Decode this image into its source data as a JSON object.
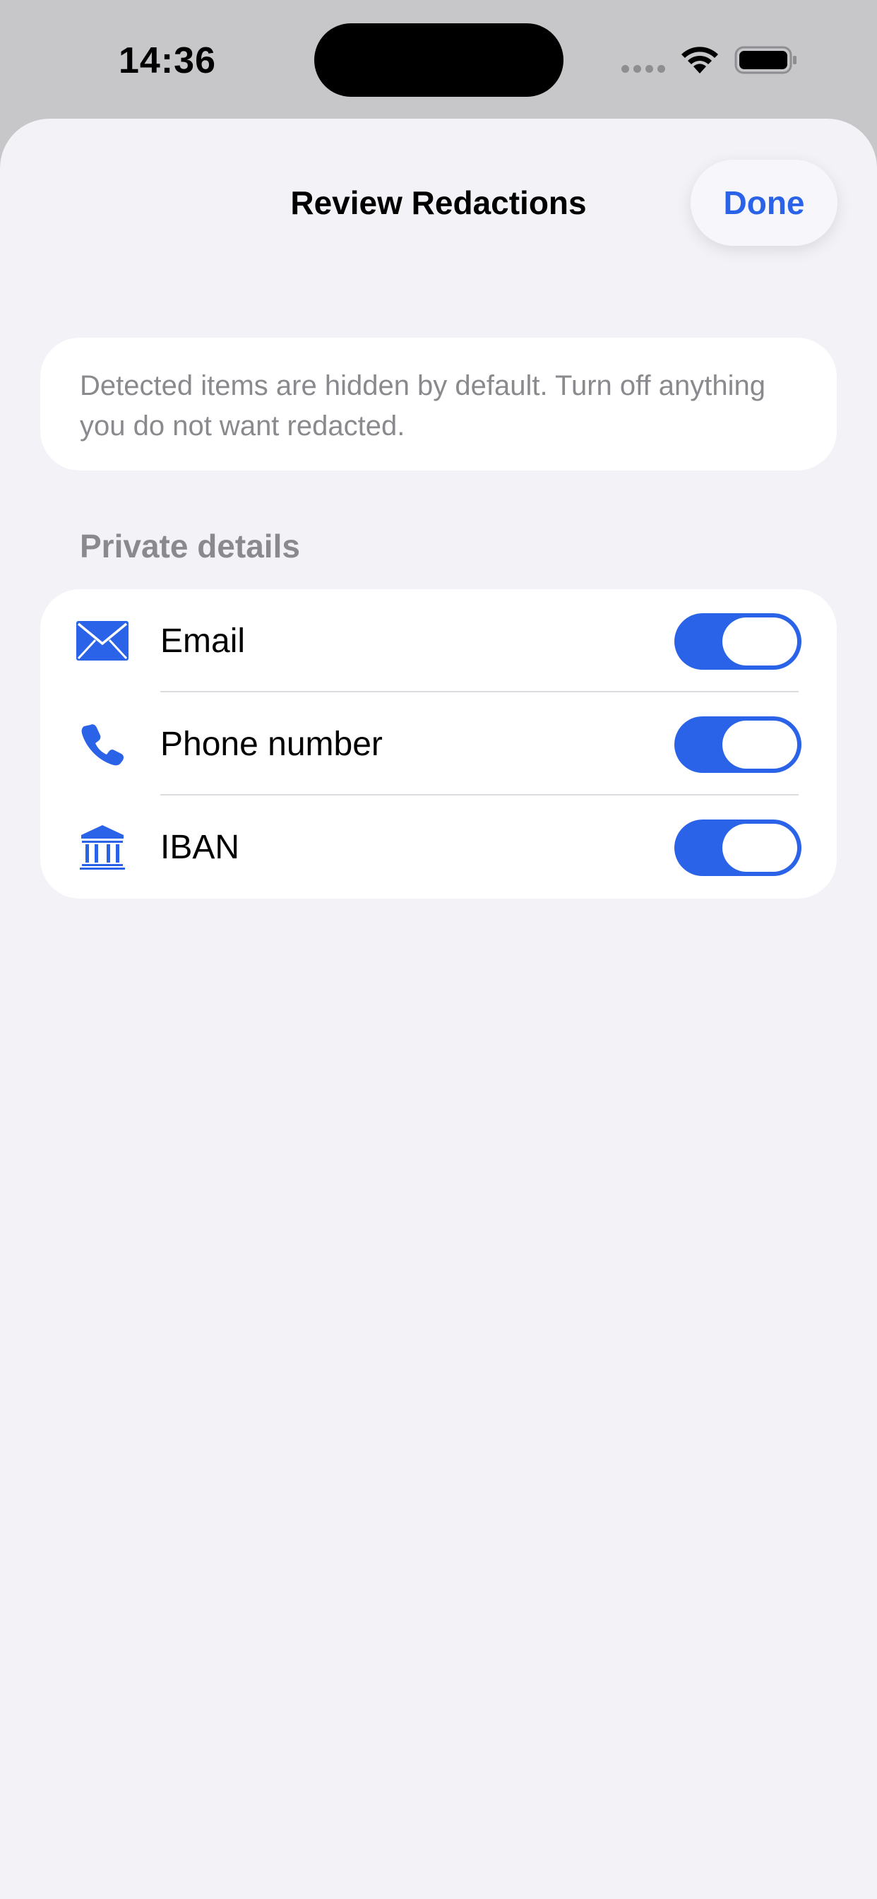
{
  "status_bar": {
    "time": "14:36"
  },
  "sheet": {
    "title": "Review Redactions",
    "done_label": "Done",
    "info_text": "Detected items are hidden by default. Turn off anything you do not want redacted.",
    "section_header": "Private details",
    "items": [
      {
        "label": "Email",
        "icon": "envelope-icon",
        "enabled": true
      },
      {
        "label": "Phone number",
        "icon": "phone-icon",
        "enabled": true
      },
      {
        "label": "IBAN",
        "icon": "bank-icon",
        "enabled": true
      }
    ]
  },
  "colors": {
    "accent": "#2a63e8",
    "background": "#f2f2f7",
    "secondary_text": "#8a8a8e"
  }
}
